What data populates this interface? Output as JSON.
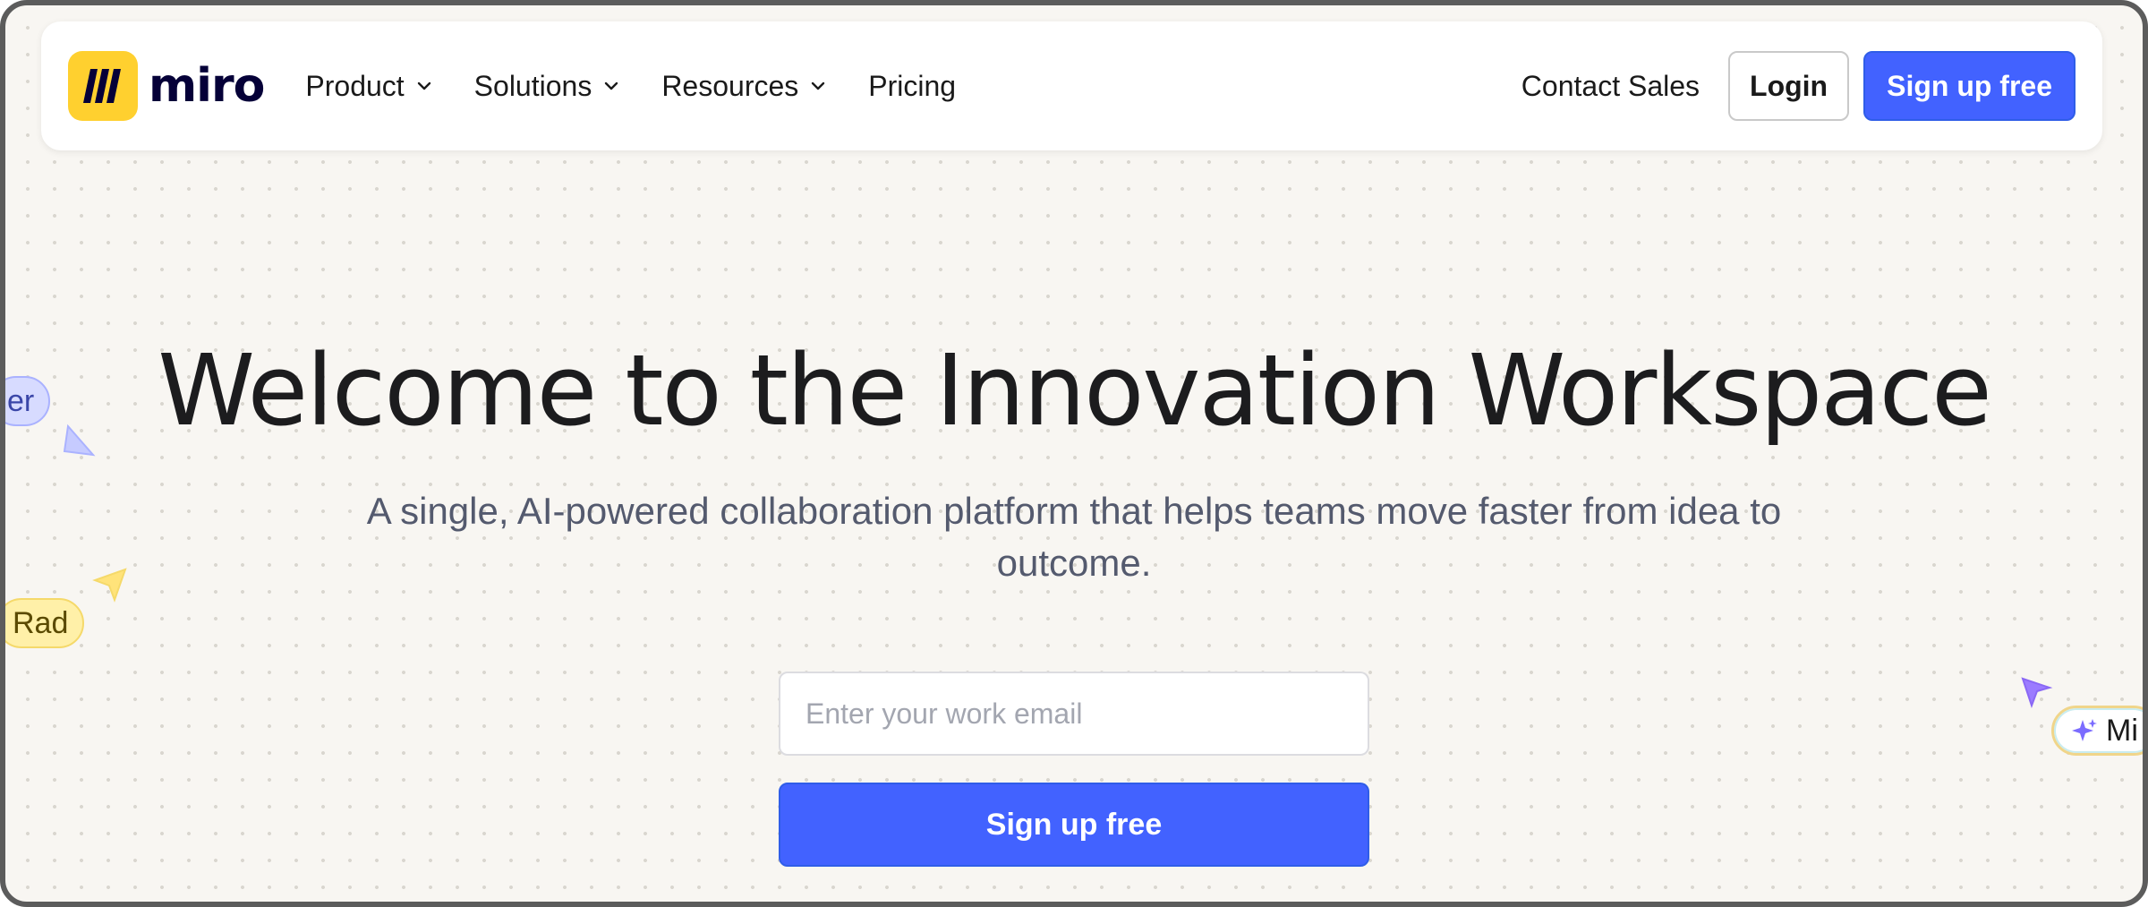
{
  "nav": {
    "logo_text": "miro",
    "items": [
      {
        "label": "Product",
        "dropdown": true
      },
      {
        "label": "Solutions",
        "dropdown": true
      },
      {
        "label": "Resources",
        "dropdown": true
      },
      {
        "label": "Pricing",
        "dropdown": false
      }
    ],
    "contact_label": "Contact Sales",
    "login_label": "Login",
    "signup_label": "Sign up free"
  },
  "hero": {
    "title": "Welcome to the Innovation Workspace",
    "subtitle": "A single, AI-powered collaboration platform that helps teams move faster from idea to outcome.",
    "email_placeholder": "Enter your work email",
    "signup_label": "Sign up free"
  },
  "floating_tags": {
    "left_top": "er",
    "left_bottom": "Rad",
    "right": "Mi"
  },
  "colors": {
    "brand_yellow": "#ffd02f",
    "primary_blue": "#4262ff",
    "background": "#f8f6f2"
  }
}
